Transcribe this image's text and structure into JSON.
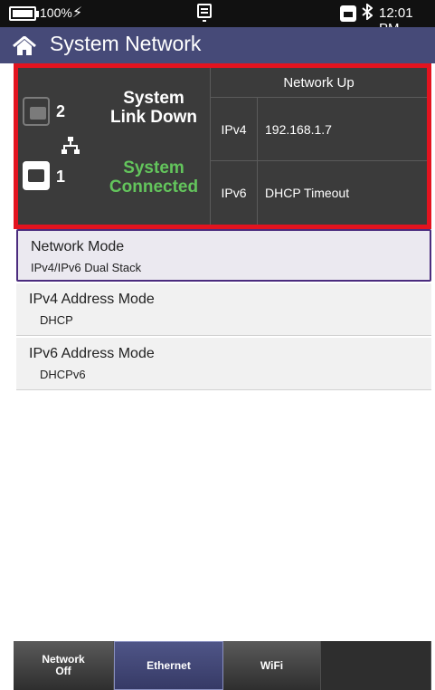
{
  "status_bar": {
    "battery_percent": "100%",
    "battery_level": 1.0,
    "charging_icon": "lightning-icon",
    "notification_icon": "notification-icon",
    "ethernet_icon": "ethernet-icon",
    "bluetooth_icon": "bluetooth-icon",
    "time": "12:01 PM"
  },
  "header": {
    "title": "System Network",
    "home_icon": "home-icon",
    "color": "#464a78"
  },
  "status_panel": {
    "border_color": "#e3131f",
    "port2": {
      "number": "2",
      "state_line1": "System",
      "state_line2": "Link Down"
    },
    "port1": {
      "number": "1",
      "state_line1": "System",
      "state_line2": "Connected",
      "state_color": "#63c55c"
    },
    "network_status": "Network Up",
    "ipv4": {
      "label": "IPv4",
      "value": "192.168.1.7"
    },
    "ipv6": {
      "label": "IPv6",
      "value": "DHCP Timeout"
    }
  },
  "settings": [
    {
      "title": "Network Mode",
      "value": "IPv4/IPv6 Dual Stack"
    },
    {
      "title": "IPv4 Address Mode",
      "value": "DHCP"
    },
    {
      "title": "IPv6 Address Mode",
      "value": "DHCPv6"
    }
  ],
  "tabs": {
    "network_off_line1": "Network",
    "network_off_line2": "Off",
    "ethernet": "Ethernet",
    "wifi": "WiFi",
    "active": "Ethernet"
  }
}
